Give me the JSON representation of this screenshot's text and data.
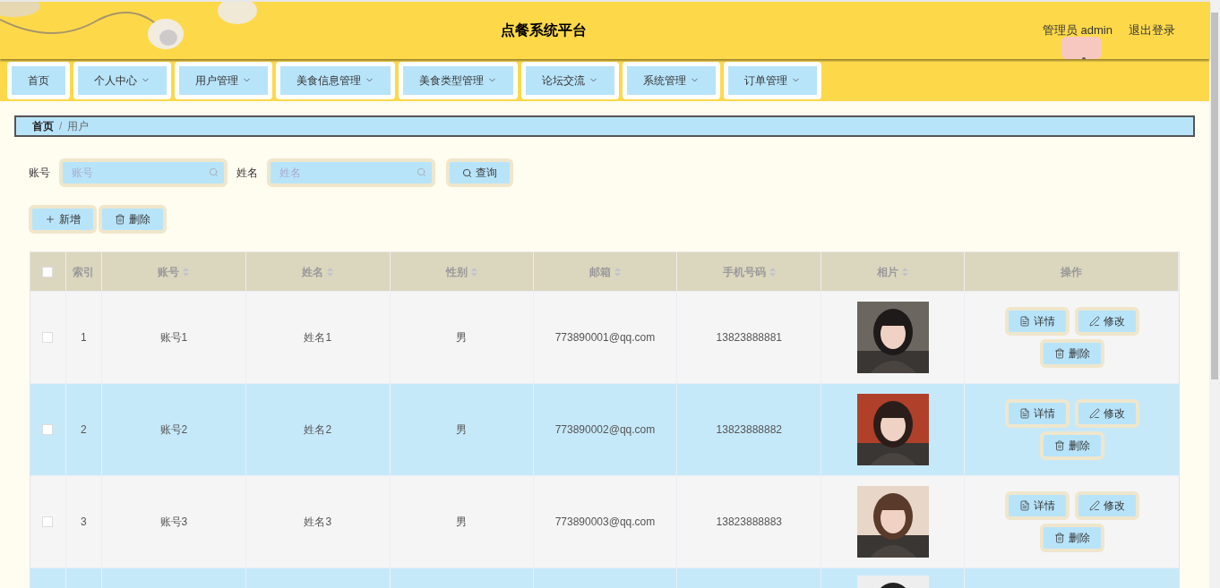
{
  "header": {
    "title": "点餐系统平台",
    "user": "管理员 admin",
    "logout": "退出登录"
  },
  "nav": [
    {
      "label": "首页",
      "dropdown": false
    },
    {
      "label": "个人中心",
      "dropdown": true
    },
    {
      "label": "用户管理",
      "dropdown": true
    },
    {
      "label": "美食信息管理",
      "dropdown": true
    },
    {
      "label": "美食类型管理",
      "dropdown": true
    },
    {
      "label": "论坛交流",
      "dropdown": true
    },
    {
      "label": "系统管理",
      "dropdown": true
    },
    {
      "label": "订单管理",
      "dropdown": true
    }
  ],
  "breadcrumb": [
    "首页",
    "用户"
  ],
  "breadcrumb_separator": "/",
  "search": {
    "fields": [
      {
        "label": "账号",
        "placeholder": "账号"
      },
      {
        "label": "姓名",
        "placeholder": "姓名"
      }
    ],
    "button": "查询"
  },
  "actions": {
    "add": "新增",
    "delete": "删除"
  },
  "table": {
    "columns": [
      {
        "label": "索引",
        "sortable": false
      },
      {
        "label": "账号",
        "sortable": true
      },
      {
        "label": "姓名",
        "sortable": true
      },
      {
        "label": "性别",
        "sortable": true
      },
      {
        "label": "邮箱",
        "sortable": true
      },
      {
        "label": "手机号码",
        "sortable": true
      },
      {
        "label": "相片",
        "sortable": true
      },
      {
        "label": "操作",
        "sortable": false
      }
    ],
    "select_all_checked": false,
    "rows": [
      {
        "checked": false,
        "cells": [
          "1",
          "账号1",
          "姓名1",
          "男",
          "773890001@qq.com",
          "13823888881"
        ],
        "buttons": [
          "详情",
          "修改",
          "删除"
        ]
      },
      {
        "checked": false,
        "cells": [
          "2",
          "账号2",
          "姓名2",
          "男",
          "773890002@qq.com",
          "13823888882"
        ],
        "buttons": [
          "详情",
          "修改",
          "删除"
        ]
      },
      {
        "checked": false,
        "cells": [
          "3",
          "账号3",
          "姓名3",
          "男",
          "773890003@qq.com",
          "13823888883"
        ],
        "buttons": [
          "详情",
          "修改",
          "删除"
        ]
      }
    ]
  }
}
